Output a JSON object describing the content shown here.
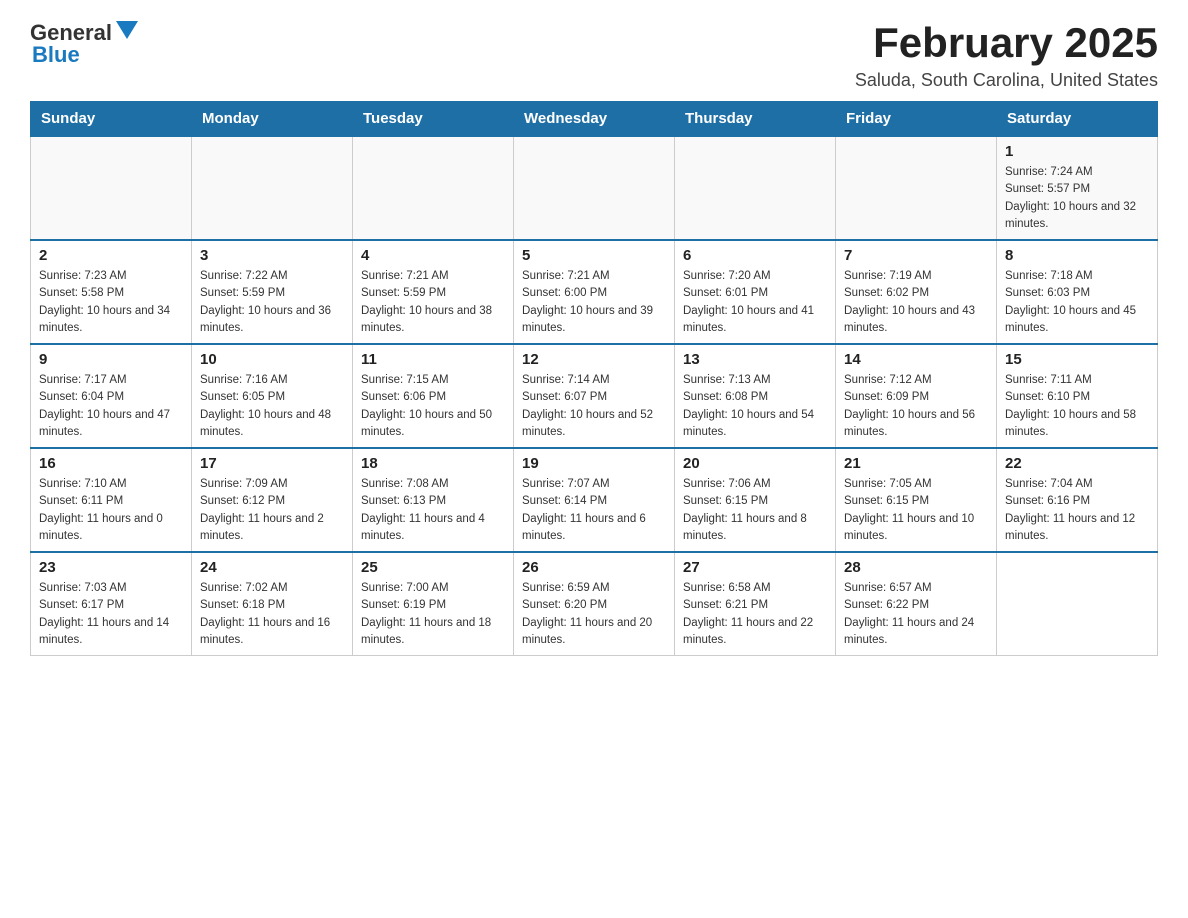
{
  "header": {
    "logo_general": "General",
    "logo_blue": "Blue",
    "month_year": "February 2025",
    "location": "Saluda, South Carolina, United States"
  },
  "weekdays": [
    "Sunday",
    "Monday",
    "Tuesday",
    "Wednesday",
    "Thursday",
    "Friday",
    "Saturday"
  ],
  "weeks": [
    [
      {
        "day": "",
        "sunrise": "",
        "sunset": "",
        "daylight": ""
      },
      {
        "day": "",
        "sunrise": "",
        "sunset": "",
        "daylight": ""
      },
      {
        "day": "",
        "sunrise": "",
        "sunset": "",
        "daylight": ""
      },
      {
        "day": "",
        "sunrise": "",
        "sunset": "",
        "daylight": ""
      },
      {
        "day": "",
        "sunrise": "",
        "sunset": "",
        "daylight": ""
      },
      {
        "day": "",
        "sunrise": "",
        "sunset": "",
        "daylight": ""
      },
      {
        "day": "1",
        "sunrise": "Sunrise: 7:24 AM",
        "sunset": "Sunset: 5:57 PM",
        "daylight": "Daylight: 10 hours and 32 minutes."
      }
    ],
    [
      {
        "day": "2",
        "sunrise": "Sunrise: 7:23 AM",
        "sunset": "Sunset: 5:58 PM",
        "daylight": "Daylight: 10 hours and 34 minutes."
      },
      {
        "day": "3",
        "sunrise": "Sunrise: 7:22 AM",
        "sunset": "Sunset: 5:59 PM",
        "daylight": "Daylight: 10 hours and 36 minutes."
      },
      {
        "day": "4",
        "sunrise": "Sunrise: 7:21 AM",
        "sunset": "Sunset: 5:59 PM",
        "daylight": "Daylight: 10 hours and 38 minutes."
      },
      {
        "day": "5",
        "sunrise": "Sunrise: 7:21 AM",
        "sunset": "Sunset: 6:00 PM",
        "daylight": "Daylight: 10 hours and 39 minutes."
      },
      {
        "day": "6",
        "sunrise": "Sunrise: 7:20 AM",
        "sunset": "Sunset: 6:01 PM",
        "daylight": "Daylight: 10 hours and 41 minutes."
      },
      {
        "day": "7",
        "sunrise": "Sunrise: 7:19 AM",
        "sunset": "Sunset: 6:02 PM",
        "daylight": "Daylight: 10 hours and 43 minutes."
      },
      {
        "day": "8",
        "sunrise": "Sunrise: 7:18 AM",
        "sunset": "Sunset: 6:03 PM",
        "daylight": "Daylight: 10 hours and 45 minutes."
      }
    ],
    [
      {
        "day": "9",
        "sunrise": "Sunrise: 7:17 AM",
        "sunset": "Sunset: 6:04 PM",
        "daylight": "Daylight: 10 hours and 47 minutes."
      },
      {
        "day": "10",
        "sunrise": "Sunrise: 7:16 AM",
        "sunset": "Sunset: 6:05 PM",
        "daylight": "Daylight: 10 hours and 48 minutes."
      },
      {
        "day": "11",
        "sunrise": "Sunrise: 7:15 AM",
        "sunset": "Sunset: 6:06 PM",
        "daylight": "Daylight: 10 hours and 50 minutes."
      },
      {
        "day": "12",
        "sunrise": "Sunrise: 7:14 AM",
        "sunset": "Sunset: 6:07 PM",
        "daylight": "Daylight: 10 hours and 52 minutes."
      },
      {
        "day": "13",
        "sunrise": "Sunrise: 7:13 AM",
        "sunset": "Sunset: 6:08 PM",
        "daylight": "Daylight: 10 hours and 54 minutes."
      },
      {
        "day": "14",
        "sunrise": "Sunrise: 7:12 AM",
        "sunset": "Sunset: 6:09 PM",
        "daylight": "Daylight: 10 hours and 56 minutes."
      },
      {
        "day": "15",
        "sunrise": "Sunrise: 7:11 AM",
        "sunset": "Sunset: 6:10 PM",
        "daylight": "Daylight: 10 hours and 58 minutes."
      }
    ],
    [
      {
        "day": "16",
        "sunrise": "Sunrise: 7:10 AM",
        "sunset": "Sunset: 6:11 PM",
        "daylight": "Daylight: 11 hours and 0 minutes."
      },
      {
        "day": "17",
        "sunrise": "Sunrise: 7:09 AM",
        "sunset": "Sunset: 6:12 PM",
        "daylight": "Daylight: 11 hours and 2 minutes."
      },
      {
        "day": "18",
        "sunrise": "Sunrise: 7:08 AM",
        "sunset": "Sunset: 6:13 PM",
        "daylight": "Daylight: 11 hours and 4 minutes."
      },
      {
        "day": "19",
        "sunrise": "Sunrise: 7:07 AM",
        "sunset": "Sunset: 6:14 PM",
        "daylight": "Daylight: 11 hours and 6 minutes."
      },
      {
        "day": "20",
        "sunrise": "Sunrise: 7:06 AM",
        "sunset": "Sunset: 6:15 PM",
        "daylight": "Daylight: 11 hours and 8 minutes."
      },
      {
        "day": "21",
        "sunrise": "Sunrise: 7:05 AM",
        "sunset": "Sunset: 6:15 PM",
        "daylight": "Daylight: 11 hours and 10 minutes."
      },
      {
        "day": "22",
        "sunrise": "Sunrise: 7:04 AM",
        "sunset": "Sunset: 6:16 PM",
        "daylight": "Daylight: 11 hours and 12 minutes."
      }
    ],
    [
      {
        "day": "23",
        "sunrise": "Sunrise: 7:03 AM",
        "sunset": "Sunset: 6:17 PM",
        "daylight": "Daylight: 11 hours and 14 minutes."
      },
      {
        "day": "24",
        "sunrise": "Sunrise: 7:02 AM",
        "sunset": "Sunset: 6:18 PM",
        "daylight": "Daylight: 11 hours and 16 minutes."
      },
      {
        "day": "25",
        "sunrise": "Sunrise: 7:00 AM",
        "sunset": "Sunset: 6:19 PM",
        "daylight": "Daylight: 11 hours and 18 minutes."
      },
      {
        "day": "26",
        "sunrise": "Sunrise: 6:59 AM",
        "sunset": "Sunset: 6:20 PM",
        "daylight": "Daylight: 11 hours and 20 minutes."
      },
      {
        "day": "27",
        "sunrise": "Sunrise: 6:58 AM",
        "sunset": "Sunset: 6:21 PM",
        "daylight": "Daylight: 11 hours and 22 minutes."
      },
      {
        "day": "28",
        "sunrise": "Sunrise: 6:57 AM",
        "sunset": "Sunset: 6:22 PM",
        "daylight": "Daylight: 11 hours and 24 minutes."
      },
      {
        "day": "",
        "sunrise": "",
        "sunset": "",
        "daylight": ""
      }
    ]
  ]
}
